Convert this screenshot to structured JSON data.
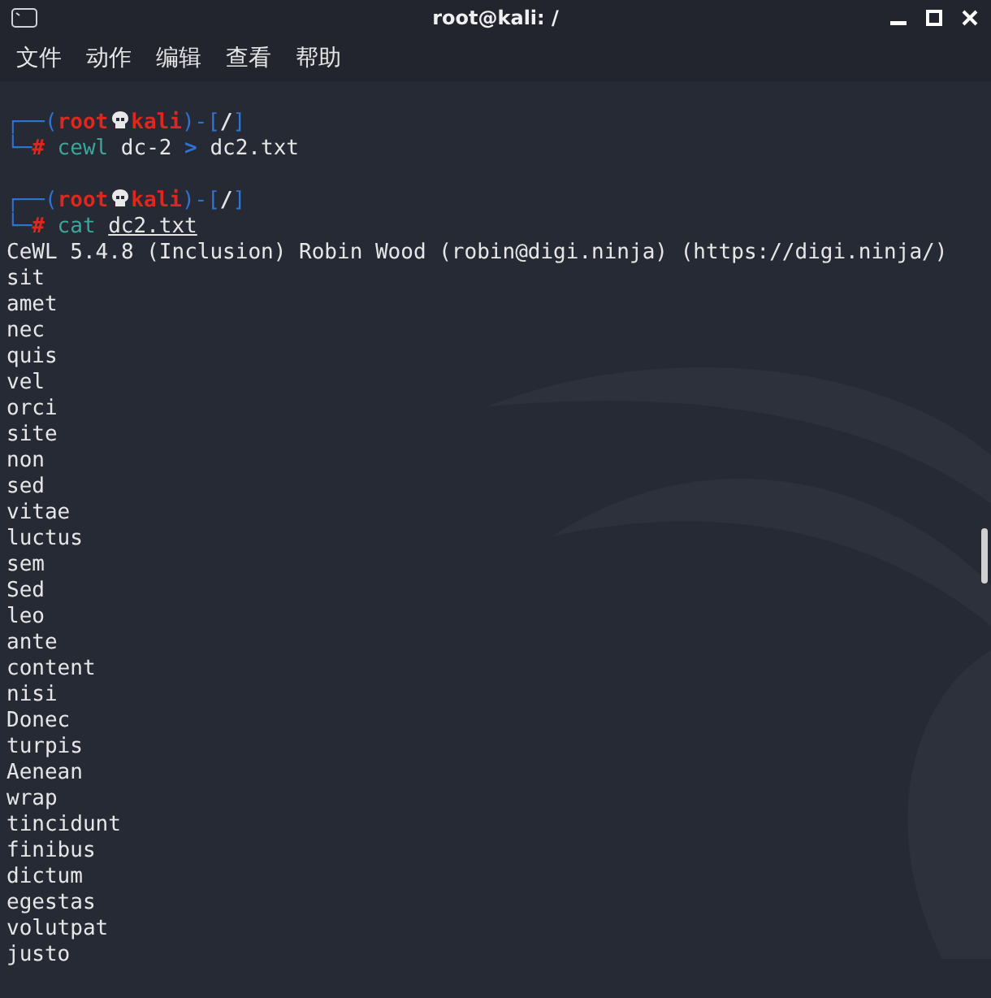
{
  "window": {
    "title": "root@kali: /"
  },
  "menu": [
    "文件",
    "动作",
    "编辑",
    "查看",
    "帮助"
  ],
  "terminal": {
    "lines": [
      {
        "kind": "blank"
      },
      {
        "kind": "segments",
        "parts": [
          {
            "kind": "frame",
            "text": "┌──("
          },
          {
            "kind": "user",
            "text": "root"
          },
          {
            "kind": "skull"
          },
          {
            "kind": "host",
            "text": "kali"
          },
          {
            "kind": "frame",
            "text": ")-["
          },
          {
            "kind": "path",
            "text": "/"
          },
          {
            "kind": "frame",
            "text": "]"
          }
        ]
      },
      {
        "kind": "segments",
        "parts": [
          {
            "kind": "frame",
            "text": "└─"
          },
          {
            "kind": "hash",
            "text": "#"
          },
          {
            "kind": "cmd",
            "text": "cewl"
          },
          {
            "kind": "arg",
            "text": "dc-2"
          },
          {
            "kind": "op",
            "text": ">"
          },
          {
            "kind": "arg",
            "text": "dc2.txt"
          }
        ]
      },
      {
        "kind": "blank"
      },
      {
        "kind": "segments",
        "parts": [
          {
            "kind": "frame",
            "text": "┌──("
          },
          {
            "kind": "user",
            "text": "root"
          },
          {
            "kind": "skull"
          },
          {
            "kind": "host",
            "text": "kali"
          },
          {
            "kind": "frame",
            "text": ")-["
          },
          {
            "kind": "path",
            "text": "/"
          },
          {
            "kind": "frame",
            "text": "]"
          }
        ]
      },
      {
        "kind": "segments",
        "parts": [
          {
            "kind": "frame",
            "text": "└─"
          },
          {
            "kind": "hash",
            "text": "#"
          },
          {
            "kind": "cmd",
            "text": "cat"
          },
          {
            "kind": "file",
            "text": "dc2.txt"
          }
        ]
      },
      {
        "kind": "output",
        "text": "CeWL 5.4.8 (Inclusion) Robin Wood (robin@digi.ninja) (https://digi.ninja/)"
      },
      {
        "kind": "output",
        "text": "sit"
      },
      {
        "kind": "output",
        "text": "amet"
      },
      {
        "kind": "output",
        "text": "nec"
      },
      {
        "kind": "output",
        "text": "quis"
      },
      {
        "kind": "output",
        "text": "vel"
      },
      {
        "kind": "output",
        "text": "orci"
      },
      {
        "kind": "output",
        "text": "site"
      },
      {
        "kind": "output",
        "text": "non"
      },
      {
        "kind": "output",
        "text": "sed"
      },
      {
        "kind": "output",
        "text": "vitae"
      },
      {
        "kind": "output",
        "text": "luctus"
      },
      {
        "kind": "output",
        "text": "sem"
      },
      {
        "kind": "output",
        "text": "Sed"
      },
      {
        "kind": "output",
        "text": "leo"
      },
      {
        "kind": "output",
        "text": "ante"
      },
      {
        "kind": "output",
        "text": "content"
      },
      {
        "kind": "output",
        "text": "nisi"
      },
      {
        "kind": "output",
        "text": "Donec"
      },
      {
        "kind": "output",
        "text": "turpis"
      },
      {
        "kind": "output",
        "text": "Aenean"
      },
      {
        "kind": "output",
        "text": "wrap"
      },
      {
        "kind": "output",
        "text": "tincidunt"
      },
      {
        "kind": "output",
        "text": "finibus"
      },
      {
        "kind": "output",
        "text": "dictum"
      },
      {
        "kind": "output",
        "text": "egestas"
      },
      {
        "kind": "output",
        "text": "volutpat"
      },
      {
        "kind": "output",
        "text": "justo"
      }
    ]
  }
}
